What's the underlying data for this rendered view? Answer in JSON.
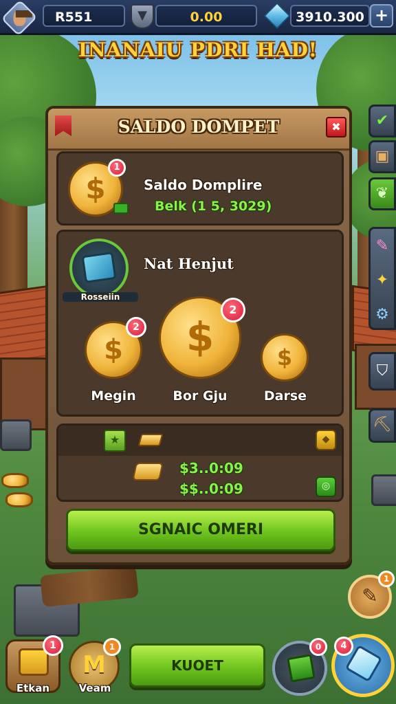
{
  "topbar": {
    "player_name": "R551",
    "gold": "0.00",
    "gems": "3910.300",
    "plus_label": "+"
  },
  "banner": {
    "title": "INANAIU PDRI HAD!"
  },
  "panel": {
    "title": "SALDO DOMPET",
    "close_label": "✖",
    "balance": {
      "label": "Saldo Domplire",
      "value": "Belk (1 5, 3029)",
      "coin_badge": "1"
    },
    "next": {
      "label": "Nat Henjut",
      "chest_label": "Rosseiin"
    },
    "coins": [
      {
        "label": "Megin",
        "badge": "2"
      },
      {
        "label": "Bor Gju",
        "badge": "2"
      },
      {
        "label": "Darse",
        "badge": ""
      }
    ],
    "rewards": {
      "line1": "$3..0:09",
      "line2": "$$..0:09"
    },
    "action_button": "SGNAIC OMERI"
  },
  "bottom": {
    "shop_label": "Etkan",
    "shop_badge": "1",
    "team_label": "Veam",
    "team_badge": "1",
    "center_button": "KUOET",
    "gift_badge": "0",
    "tool_badge": "4",
    "quest_badge": "1"
  },
  "colors": {
    "accent_green": "#8cf04a",
    "gold": "#ffd23a",
    "badge_red": "#d81b3a"
  }
}
